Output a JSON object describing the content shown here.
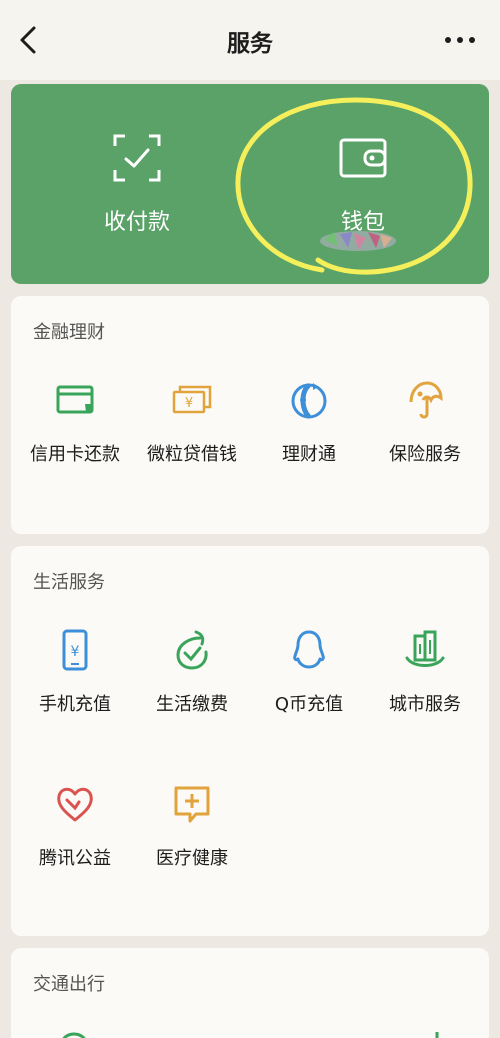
{
  "header": {
    "title": "服务"
  },
  "top_card": {
    "pay_label": "收付款",
    "wallet_label": "钱包",
    "bg_color": "#5aa268"
  },
  "finance": {
    "title": "金融理财",
    "items": [
      {
        "label": "信用卡还款",
        "icon": "credit-card-icon",
        "color": "#3aa55a"
      },
      {
        "label": "微粒贷借钱",
        "icon": "yuan-cards-icon",
        "color": "#e2a33c"
      },
      {
        "label": "理财通",
        "icon": "wealth-icon",
        "color": "#3c8fd8"
      },
      {
        "label": "保险服务",
        "icon": "umbrella-icon",
        "color": "#e2a33c"
      }
    ]
  },
  "life": {
    "title": "生活服务",
    "items": [
      {
        "label": "手机充值",
        "icon": "phone-yuan-icon",
        "color": "#3c8fd8"
      },
      {
        "label": "生活缴费",
        "icon": "check-leaf-icon",
        "color": "#3aa55a"
      },
      {
        "label": "Q币充值",
        "icon": "penguin-icon",
        "color": "#3c8fd8"
      },
      {
        "label": "城市服务",
        "icon": "city-icon",
        "color": "#3aa55a"
      },
      {
        "label": "腾讯公益",
        "icon": "heart-icon",
        "color": "#d9534f"
      },
      {
        "label": "医疗健康",
        "icon": "medical-chat-icon",
        "color": "#e2a33c"
      }
    ]
  },
  "transport": {
    "title": "交通出行"
  }
}
